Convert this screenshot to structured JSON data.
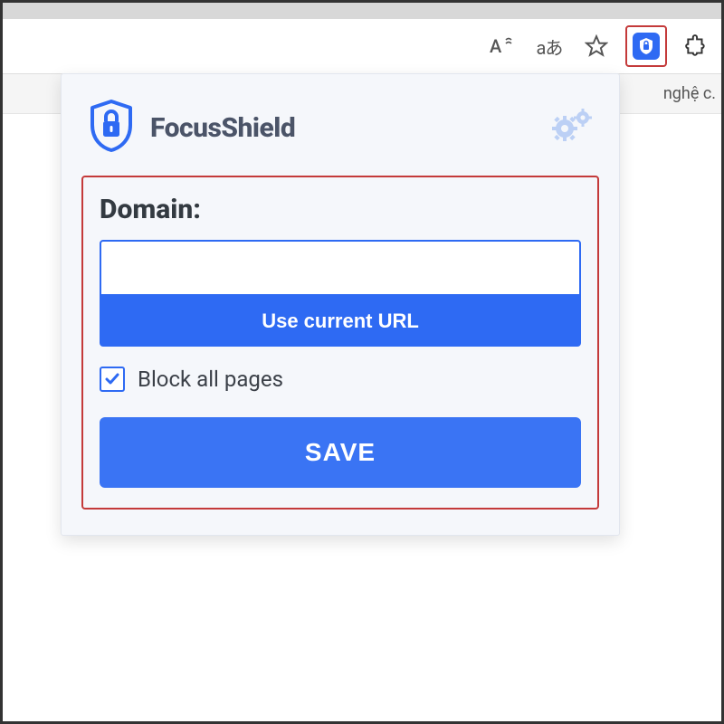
{
  "toolbar": {
    "text_size_label": "A",
    "translate_label": "aあ",
    "partial_text": "nghệ c."
  },
  "popup": {
    "brand": "FocusShield",
    "domain_label": "Domain:",
    "domain_value": "",
    "use_current_url": "Use current URL",
    "block_all_pages": "Block all pages",
    "block_all_checked": true,
    "save": "SAVE"
  },
  "colors": {
    "primary": "#2e6af3",
    "highlight_border": "#c43a3a"
  }
}
